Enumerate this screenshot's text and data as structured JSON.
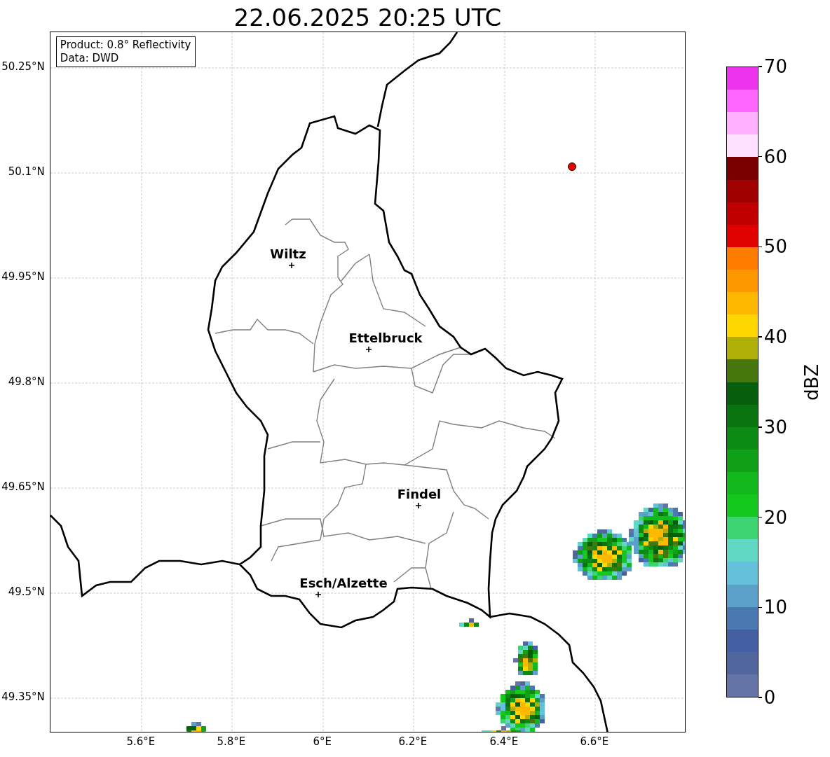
{
  "title": "22.06.2025 20:25 UTC",
  "info_box": {
    "lines": [
      "Product: 0.8° Reflectivity",
      "Data: DWD"
    ]
  },
  "y_ticks": [
    "50.25°N",
    "50.1°N",
    "49.95°N",
    "49.8°N",
    "49.65°N",
    "49.5°N",
    "49.35°N"
  ],
  "x_ticks": [
    "5.6°E",
    "5.8°E",
    "6°E",
    "6.2°E",
    "6.4°E",
    "6.6°E"
  ],
  "cities": [
    {
      "name": "Wiltz"
    },
    {
      "name": "Ettelbruck"
    },
    {
      "name": "Findel"
    },
    {
      "name": "Esch/Alzette"
    }
  ],
  "colorbar": {
    "label": "dBZ",
    "ticks": [
      "70",
      "60",
      "50",
      "40",
      "30",
      "20",
      "10",
      "0"
    ],
    "bins": [
      {
        "color": "#ee33ee"
      },
      {
        "color": "#ff66ff"
      },
      {
        "color": "#ffb0ff"
      },
      {
        "color": "#ffe0ff"
      },
      {
        "color": "#780000"
      },
      {
        "color": "#a00000"
      },
      {
        "color": "#c00000"
      },
      {
        "color": "#e00000"
      },
      {
        "color": "#fe7c00"
      },
      {
        "color": "#fe9800"
      },
      {
        "color": "#feb800"
      },
      {
        "color": "#fed600"
      },
      {
        "color": "#b0b008"
      },
      {
        "color": "#45770c"
      },
      {
        "color": "#075e0c"
      },
      {
        "color": "#0a7410"
      },
      {
        "color": "#0c8a14"
      },
      {
        "color": "#10a018"
      },
      {
        "color": "#12b81c"
      },
      {
        "color": "#14c81e"
      },
      {
        "color": "#3cd470"
      },
      {
        "color": "#60d8c4"
      },
      {
        "color": "#65c0dc"
      },
      {
        "color": "#5aa0c8"
      },
      {
        "color": "#4a78b0"
      },
      {
        "color": "#4460a3"
      },
      {
        "color": "#52669e"
      },
      {
        "color": "#6474a6"
      }
    ]
  }
}
